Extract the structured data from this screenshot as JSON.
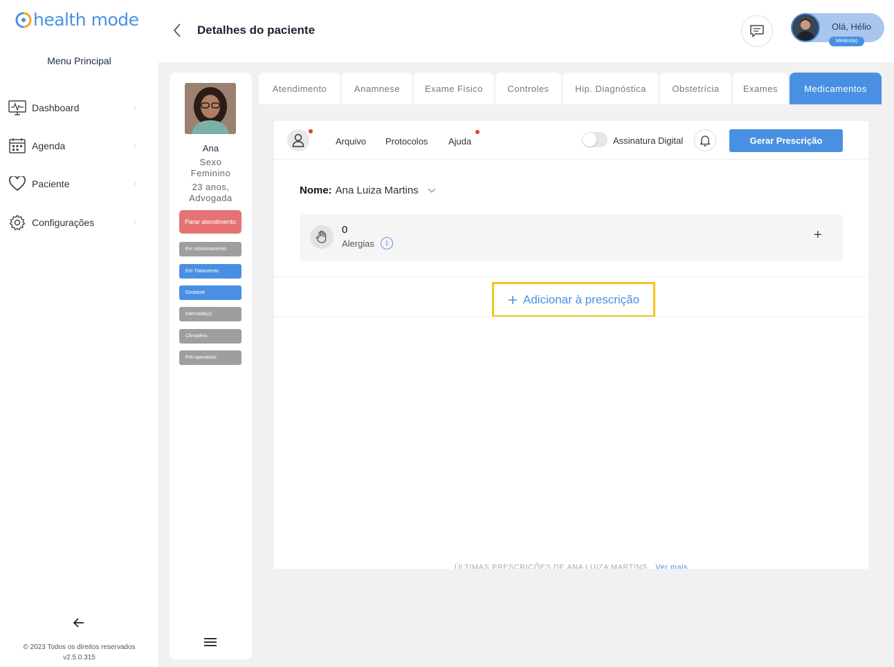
{
  "brand": {
    "logo_text": "health mode",
    "accent": "#4a90e2"
  },
  "sidebar": {
    "menu_title": "Menu Principal",
    "items": [
      {
        "label": "Dashboard",
        "icon": "monitor-icon"
      },
      {
        "label": "Agenda",
        "icon": "calendar-icon"
      },
      {
        "label": "Paciente",
        "icon": "heart-icon"
      },
      {
        "label": "Configurações",
        "icon": "gear-icon"
      }
    ],
    "copyright": "© 2023 Todos os direitos reservados",
    "version": "v2.5.0.315"
  },
  "header": {
    "title": "Detalhes do paciente",
    "greeting": "Olá, Hélio",
    "role": "Médico(a)"
  },
  "patient": {
    "name": "Ana",
    "sex_label": "Sexo",
    "sex": "Feminino",
    "age_job": "23 anos,",
    "job": "Advogada",
    "stop_button": "Parar atendimento",
    "tags": [
      {
        "label": "Em monitoramento",
        "color": "#9e9e9e"
      },
      {
        "label": "Em Tratamento",
        "color": "#4a90e2"
      },
      {
        "label": "Gestante",
        "color": "#4a90e2"
      },
      {
        "label": "Internada(o)",
        "color": "#9e9e9e"
      },
      {
        "label": "Climatério",
        "color": "#9e9e9e"
      },
      {
        "label": "Pré-operatório",
        "color": "#9e9e9e"
      }
    ]
  },
  "tabs": [
    {
      "label": "Atendimento",
      "active": false
    },
    {
      "label": "Anamnese",
      "active": false
    },
    {
      "label": "Exame Fisico",
      "active": false
    },
    {
      "label": "Controles",
      "active": false
    },
    {
      "label": "Hip. Diagnóstica",
      "active": false
    },
    {
      "label": "Obstetrícia",
      "active": false
    },
    {
      "label": "Exames",
      "active": false
    },
    {
      "label": "Medicamentos",
      "active": true
    }
  ],
  "toolbar": {
    "menu": [
      "Arquivo",
      "Protocolos",
      "Ajuda"
    ],
    "toggle_label": "Assinatura Digital",
    "toggle_on": false,
    "generate_button": "Gerar Prescrição"
  },
  "prescription": {
    "name_label": "Nome:",
    "name_value": "Ana Luiza Martins",
    "allergy_count": "0",
    "allergy_label": "Alergias",
    "allergy_plus": "+",
    "add_button": "Adicionar à prescrição",
    "footer_label": "ÚLTIMAS PRESCRIÇÕES DE ANA LUIZA MARTINS",
    "footer_link": "Ver mais"
  }
}
